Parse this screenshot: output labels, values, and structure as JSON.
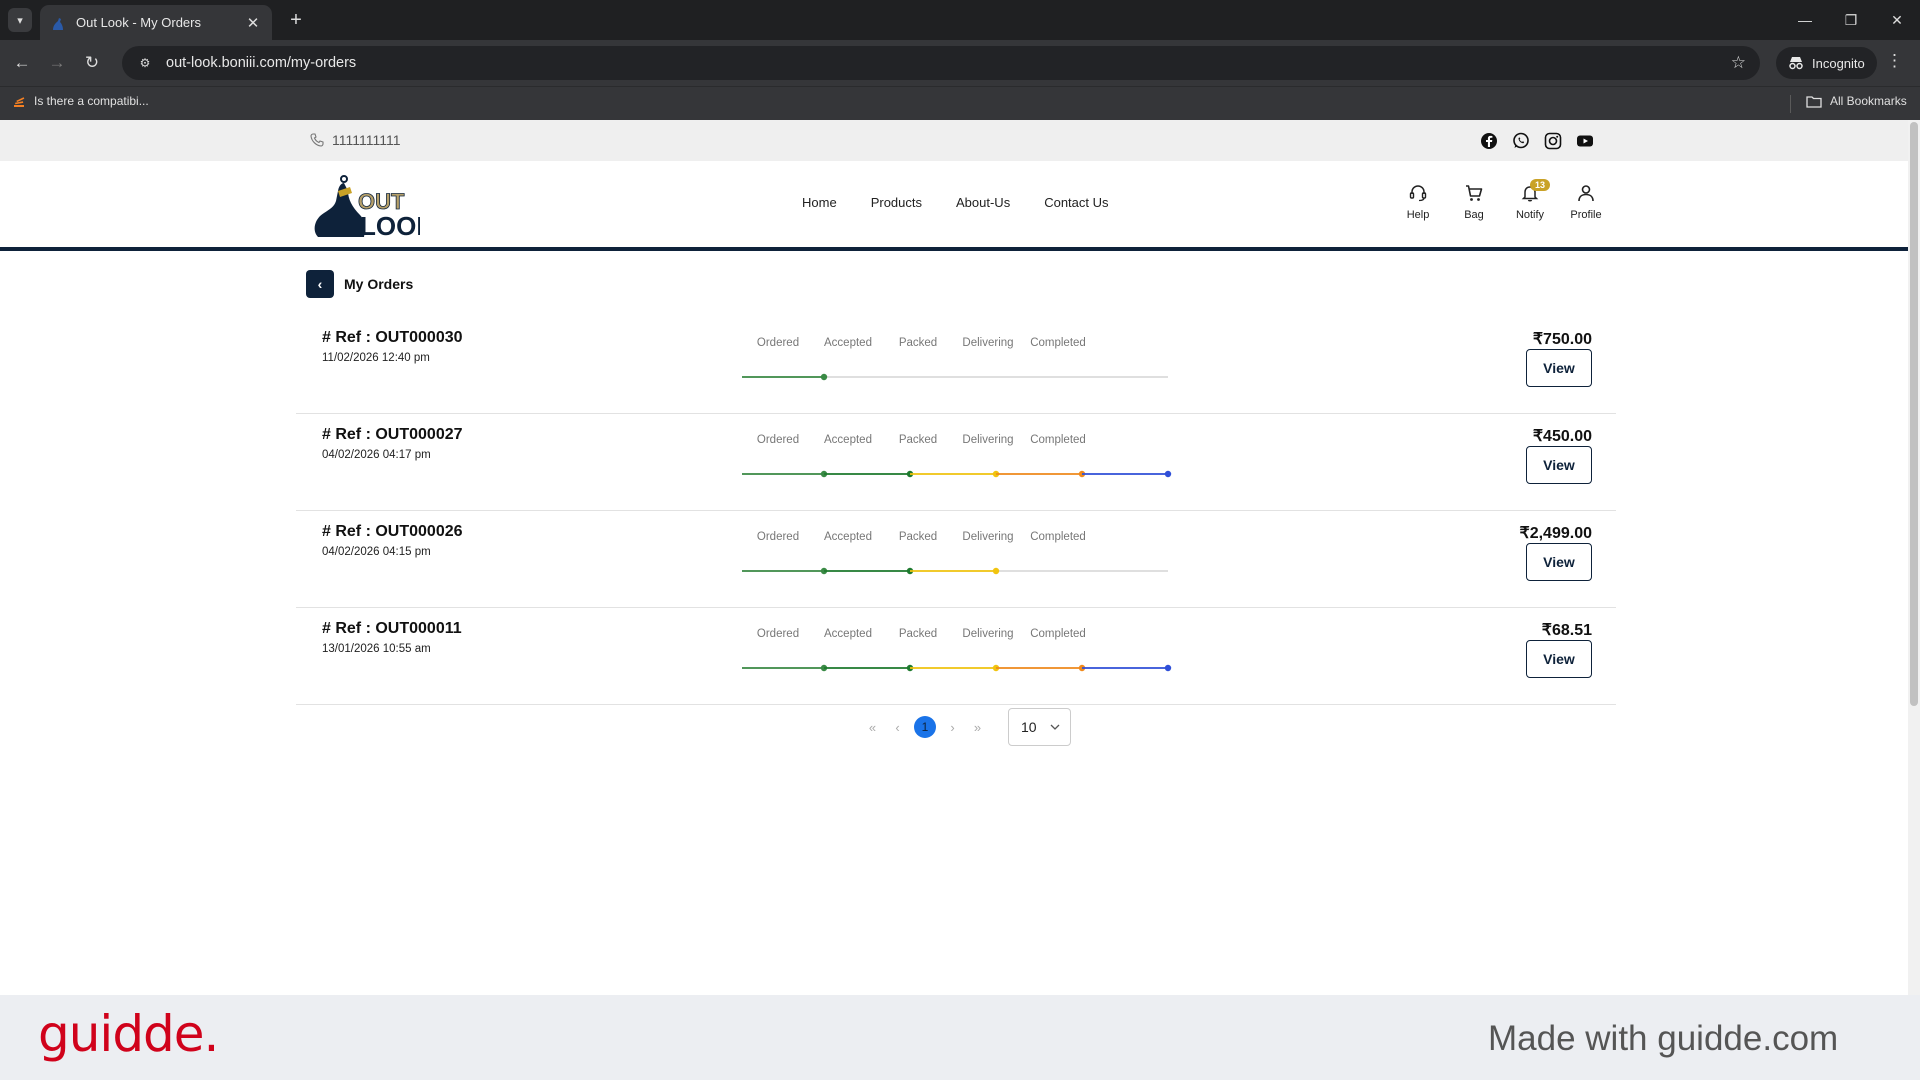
{
  "browser": {
    "tab_title": "Out Look - My Orders",
    "url": "out-look.boniii.com/my-orders",
    "incognito_label": "Incognito",
    "bookmark_item": "Is there a compatibi...",
    "all_bookmarks": "All Bookmarks"
  },
  "site": {
    "phone": "1111111111",
    "nav": {
      "home": "Home",
      "products": "Products",
      "about": "About-Us",
      "contact": "Contact Us"
    },
    "actions": {
      "help": "Help",
      "bag": "Bag",
      "notify": "Notify",
      "notify_count": "13",
      "profile": "Profile"
    },
    "brand_color": "#0e223a"
  },
  "page": {
    "title": "My Orders",
    "step_labels": [
      "Ordered",
      "Accepted",
      "Packed",
      "Delivering",
      "Completed"
    ],
    "view_label": "View"
  },
  "orders": [
    {
      "ref": "# Ref : OUT000030",
      "date": "11/02/2026 12:40 pm",
      "amount": "₹750.00",
      "progress_steps": 1
    },
    {
      "ref": "# Ref : OUT000027",
      "date": "04/02/2026 04:17 pm",
      "amount": "₹450.00",
      "progress_steps": 5
    },
    {
      "ref": "# Ref : OUT000026",
      "date": "04/02/2026 04:15 pm",
      "amount": "₹2,499.00",
      "progress_steps": 3
    },
    {
      "ref": "# Ref : OUT000011",
      "date": "13/01/2026 10:55 am",
      "amount": "₹68.51",
      "progress_steps": 5
    }
  ],
  "track_colors": [
    "#3a8a45",
    "#1e7a2e",
    "#f1c40f",
    "#f08a1c",
    "#2f4fd8"
  ],
  "pagination": {
    "first": "«",
    "prev": "‹",
    "current": "1",
    "next": "›",
    "last": "»",
    "page_size": "10"
  },
  "footer": {
    "logo": "guidde.",
    "made_with": "Made with guidde.com"
  }
}
